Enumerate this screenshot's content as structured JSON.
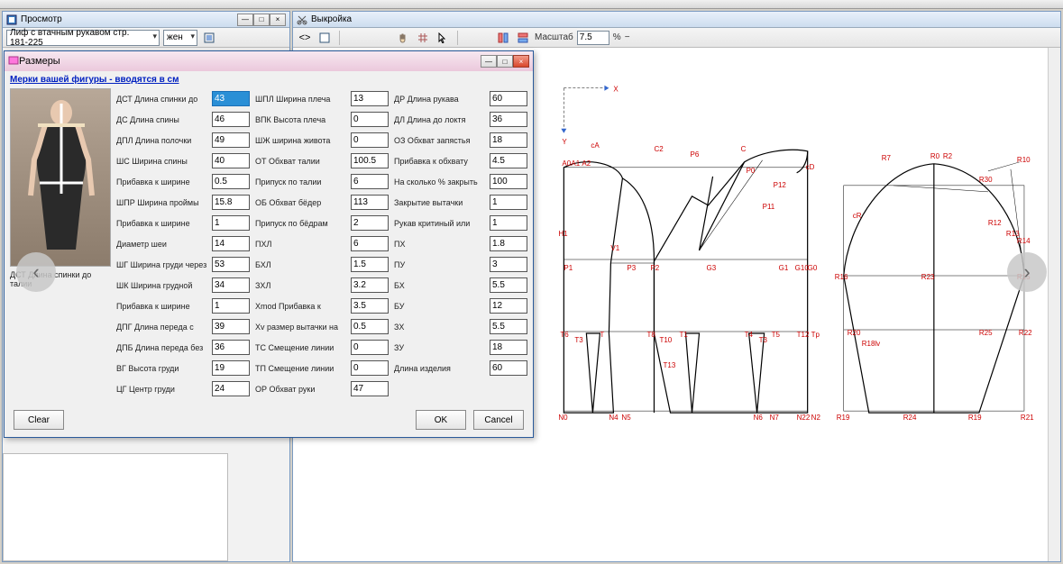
{
  "panels": {
    "left": {
      "title": "Просмотр"
    },
    "right": {
      "title": "Выкройка"
    }
  },
  "left_toolbar": {
    "pattern_name": "Лиф с втачным рукавом стр. 181-225",
    "gender": "жен"
  },
  "right_toolbar": {
    "scale_label": "Масштаб",
    "scale_value": "7.5",
    "scale_unit": "%"
  },
  "dialog": {
    "title": "Размеры",
    "link_text": "Мерки вашей фигуры - вводятся в см",
    "photo_caption": "ДСТ Длина спинки до талии",
    "buttons": {
      "clear": "Clear",
      "ok": "OK",
      "cancel": "Cancel"
    },
    "col1": [
      {
        "label": "ДСТ Длина спинки до",
        "value": "43",
        "hl": true
      },
      {
        "label": "ДС Длина спины",
        "value": "46"
      },
      {
        "label": "ДПЛ Длина полочки",
        "value": "49"
      },
      {
        "label": "ШС Ширина спины",
        "value": "40"
      },
      {
        "label": "Прибавка к ширине",
        "value": "0.5"
      },
      {
        "label": "ШПР Ширина проймы",
        "value": "15.8"
      },
      {
        "label": "Прибавка к ширине",
        "value": "1"
      },
      {
        "label": "Диаметр шеи",
        "value": "14"
      },
      {
        "label": "ШГ Ширина груди через",
        "value": "53"
      },
      {
        "label": "ШК Ширина грудной",
        "value": "34"
      },
      {
        "label": "Прибавка к ширине",
        "value": "1"
      },
      {
        "label": "ДПГ Длина переда с",
        "value": "39"
      },
      {
        "label": "ДПБ Длина переда без",
        "value": "36"
      },
      {
        "label": "ВГ Высота груди",
        "value": "19"
      },
      {
        "label": "ЦГ Центр груди",
        "value": "24"
      }
    ],
    "col2": [
      {
        "label": "ШПЛ Ширина плеча",
        "value": "13"
      },
      {
        "label": "ВПК Высота плеча",
        "value": "0"
      },
      {
        "label": "ШЖ ширина живота",
        "value": "0"
      },
      {
        "label": "ОТ Обхват талии",
        "value": "100.5"
      },
      {
        "label": "Припуск по талии",
        "value": "6"
      },
      {
        "label": "ОБ Обхват бёдер",
        "value": "113"
      },
      {
        "label": "Припуск по бёдрам",
        "value": "2"
      },
      {
        "label": "ПХЛ",
        "value": "6"
      },
      {
        "label": "БХЛ",
        "value": "1.5"
      },
      {
        "label": "ЗХЛ",
        "value": "3.2"
      },
      {
        "label": "Xmod Прибавка к",
        "value": "3.5"
      },
      {
        "label": "Xv размер вытачки на",
        "value": "0.5"
      },
      {
        "label": "ТС Смещение линии",
        "value": "0"
      },
      {
        "label": "ТП Смещение линии",
        "value": "0"
      },
      {
        "label": "ОР Обхват руки",
        "value": "47"
      }
    ],
    "col3": [
      {
        "label": "ДР Длина рукава",
        "value": "60"
      },
      {
        "label": "ДЛ Длина до локтя",
        "value": "36"
      },
      {
        "label": "ОЗ Обхват запястья",
        "value": "18"
      },
      {
        "label": "Прибавка к обхвату",
        "value": "4.5"
      },
      {
        "label": "На сколько % закрыть",
        "value": "100"
      },
      {
        "label": "Закрытие вытачки",
        "value": "1"
      },
      {
        "label": "Рукав критиный или",
        "value": "1"
      },
      {
        "label": "ПХ",
        "value": "1.8"
      },
      {
        "label": "ПУ",
        "value": "3"
      },
      {
        "label": "БХ",
        "value": "5.5"
      },
      {
        "label": "БУ",
        "value": "12"
      },
      {
        "label": "ЗХ",
        "value": "5.5"
      },
      {
        "label": "ЗУ",
        "value": "18"
      },
      {
        "label": "Длина изделия",
        "value": "60"
      }
    ]
  },
  "pattern_labels": {
    "axis_x": "X",
    "axis_y": "Y",
    "body_points": [
      "cA",
      "A0",
      "A1",
      "A2",
      "C2",
      "P0",
      "P6",
      "P1",
      "P2",
      "P11",
      "P12",
      "G0",
      "G3",
      "T",
      "T1",
      "T6",
      "T10",
      "T4",
      "T3",
      "T5",
      "T8",
      "T12",
      "Tp",
      "N0",
      "N4",
      "N5",
      "N6",
      "N7",
      "N22",
      "N2",
      "H1",
      "V1"
    ],
    "body_extra": [
      "P3",
      "G1",
      "G10",
      "C",
      "T13"
    ],
    "sleeve_points": [
      "R0",
      "R2",
      "R7",
      "R10",
      "R12",
      "R13",
      "R14",
      "R15",
      "R16",
      "R19",
      "R20",
      "R21",
      "R22",
      "R23",
      "R25",
      "R30",
      "R18lv",
      "cR",
      "cD"
    ]
  }
}
